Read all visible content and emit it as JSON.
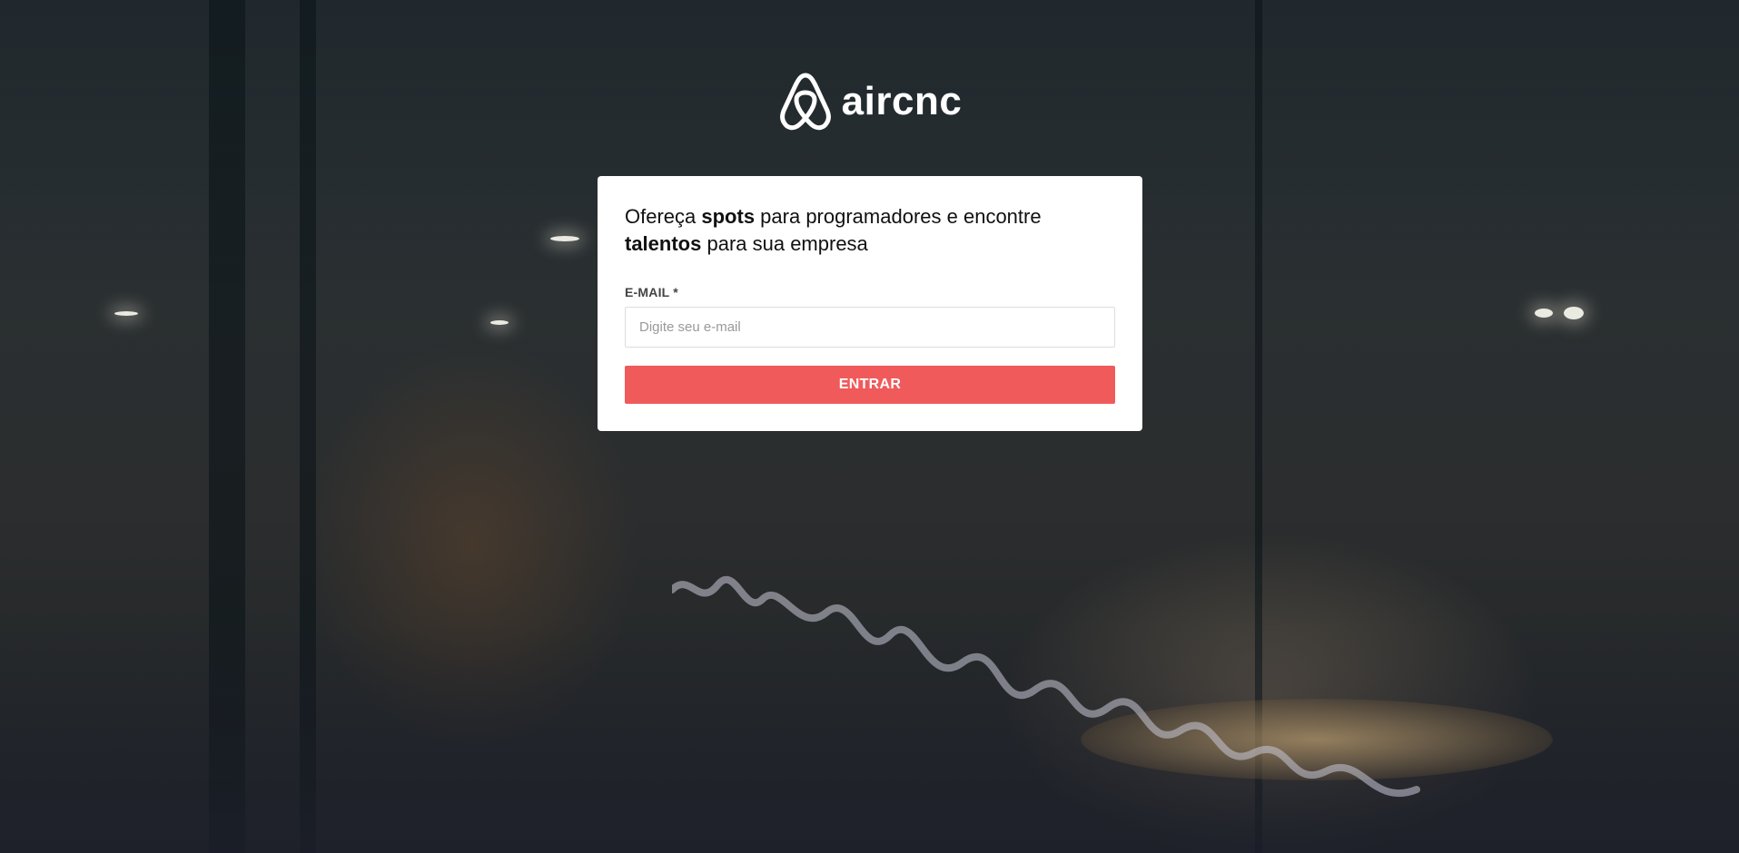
{
  "app": {
    "logo_text": "aircnc",
    "logo_icon": "airbnb-belo-icon"
  },
  "card": {
    "headline": {
      "part1": "Ofereça ",
      "bold1": "spots",
      "part2": " para programadores e encontre ",
      "bold2": "talentos",
      "part3": " para sua empresa"
    },
    "email_label": "E-MAIL *",
    "email_placeholder": "Digite seu e-mail",
    "email_value": "",
    "submit_label": "ENTRAR"
  },
  "colors": {
    "accent": "#f05a5b",
    "card_background": "#ffffff",
    "text": "#111111"
  }
}
